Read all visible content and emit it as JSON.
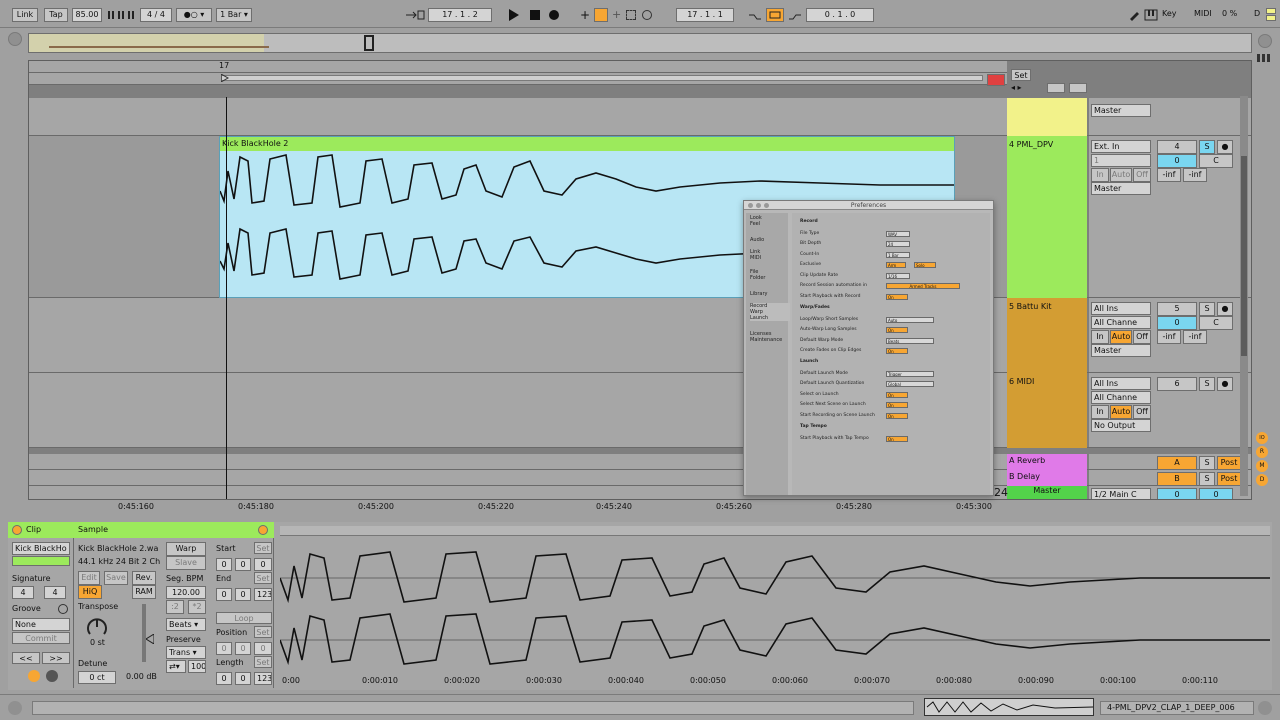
{
  "transport": {
    "link": "Link",
    "tap": "Tap",
    "tempo": "85.00",
    "time_sig_num": "4",
    "time_sig_den": "4",
    "quantize": "1 Bar",
    "arrangement_position": "17 .  1 .  2",
    "loop_start": "17 .  1 .  1",
    "loop_length": "0 .  1 .  0",
    "key_label": "Key",
    "midi_label": "MIDI",
    "cpu": "0 %",
    "disk": "D"
  },
  "arrangement": {
    "bar_marker": "17",
    "set_label": "Set",
    "time_labels": [
      "0:45:160",
      "0:45:180",
      "0:45:200",
      "0:45:220",
      "0:45:240",
      "0:45:260",
      "0:45:280",
      "0:45:300"
    ],
    "clip_name": "Kick BlackHole 2",
    "scroll_number": "24"
  },
  "tracks": [
    {
      "name": "",
      "input": "",
      "channel": "",
      "output": "Master",
      "number": "",
      "color": "#f2f28a"
    },
    {
      "name": "4 PML_DPV",
      "input": "Ext. In",
      "channel": "1",
      "output": "Master",
      "number": "4",
      "vol": "0",
      "pan": "C",
      "peak_l": "-inf",
      "peak_r": "-inf",
      "color": "#9cea5c"
    },
    {
      "name": "5 Battu Kit",
      "input": "All Ins",
      "channel": "All Channe",
      "output": "Master",
      "number": "5",
      "vol": "0",
      "pan": "C",
      "peak_l": "-inf",
      "peak_r": "-inf",
      "color": "#d39d33"
    },
    {
      "name": "6 MIDI",
      "input": "All Ins",
      "channel": "All Channe",
      "output": "No Output",
      "number": "6",
      "color": "#d39d33"
    }
  ],
  "returns": [
    {
      "name": "A Reverb",
      "letter": "A",
      "send": "Post",
      "color": "#e07ae8"
    },
    {
      "name": "B Delay",
      "letter": "B",
      "send": "Post",
      "color": "#e07ae8"
    }
  ],
  "master": {
    "name": "Master",
    "output": "1/2 Main C",
    "vol": "0",
    "pan": "0",
    "color": "#53d34a"
  },
  "monitor": {
    "in": "In",
    "auto": "Auto",
    "off": "Off",
    "solo": "S"
  },
  "prefs": {
    "title": "Preferences",
    "tabs": [
      "Look\nFeel",
      "Audio",
      "Link\nMIDI",
      "File\nFolder",
      "Library",
      "Record\nWarp\nLaunch",
      "Licenses\nMaintenance"
    ],
    "sections": {
      "record": "Record",
      "warp": "Warp/Fades",
      "launch": "Launch",
      "tap": "Tap Tempo"
    },
    "rows": [
      {
        "label": "File Type",
        "value": "WAV"
      },
      {
        "label": "Bit Depth",
        "value": "24"
      },
      {
        "label": "Count-In",
        "value": "1 Bar"
      },
      {
        "label": "Exclusive",
        "value": "Arm",
        "value2": "Solo"
      },
      {
        "label": "Clip Update Rate",
        "value": "1/16"
      },
      {
        "label": "Record Session automation in",
        "value": "Armed Tracks"
      },
      {
        "label": "Start Playback with Record",
        "value": "On"
      },
      {
        "label": "Loop/Warp Short Samples",
        "value": "Auto"
      },
      {
        "label": "Auto-Warp Long Samples",
        "value": "On"
      },
      {
        "label": "Default Warp Mode",
        "value": "Beats"
      },
      {
        "label": "Create Fades on Clip Edges",
        "value": "On"
      },
      {
        "label": "Default Launch Mode",
        "value": "Trigger"
      },
      {
        "label": "Default Launch Quantization",
        "value": "Global"
      },
      {
        "label": "Select on Launch",
        "value": "On"
      },
      {
        "label": "Select Next Scene on Launch",
        "value": "On"
      },
      {
        "label": "Start Recording on Scene Launch",
        "value": "On"
      },
      {
        "label": "Start Playback with Tap Tempo",
        "value": "On"
      }
    ]
  },
  "clip": {
    "tab_clip": "Clip",
    "tab_sample": "Sample",
    "clip_name": "Kick BlackHo",
    "signature_label": "Signature",
    "sig_num": "4",
    "sig_den": "4",
    "groove_label": "Groove",
    "groove_value": "None",
    "commit": "Commit",
    "nudge_left": "<<",
    "nudge_right": ">>",
    "sample_name": "Kick BlackHole 2.wa",
    "sample_info": "44.1 kHz 24 Bit 2 Ch",
    "edit": "Edit",
    "save": "Save",
    "rev": "Rev.",
    "hiq": "HiQ",
    "ram": "RAM",
    "transpose_label": "Transpose",
    "transpose_value": "0 st",
    "detune_label": "Detune",
    "detune_value": "0 ct",
    "gain_value": "0.00 dB",
    "warp": "Warp",
    "slave": "Slave",
    "seg_bpm_label": "Seg. BPM",
    "seg_bpm": "120.00",
    "half": ":2",
    "double": "*2",
    "beats": "Beats",
    "preserve_label": "Preserve",
    "preserve_value": "Trans",
    "grain": "100",
    "start_label": "Start",
    "end_label": "End",
    "set": "Set",
    "loop": "Loop",
    "position_label": "Position",
    "length_label": "Length",
    "zero": "0",
    "end_val": "123",
    "time_labels": [
      "0:00",
      "0:00:010",
      "0:00:020",
      "0:00:030",
      "0:00:040",
      "0:00:050",
      "0:00:060",
      "0:00:070",
      "0:00:080",
      "0:00:090",
      "0:00:100",
      "0:00:110"
    ]
  },
  "status": {
    "track_name": "4-PML_DPV2_CLAP_1_DEEP_006"
  },
  "side_icons": [
    "IO",
    "R",
    "M",
    "D"
  ]
}
